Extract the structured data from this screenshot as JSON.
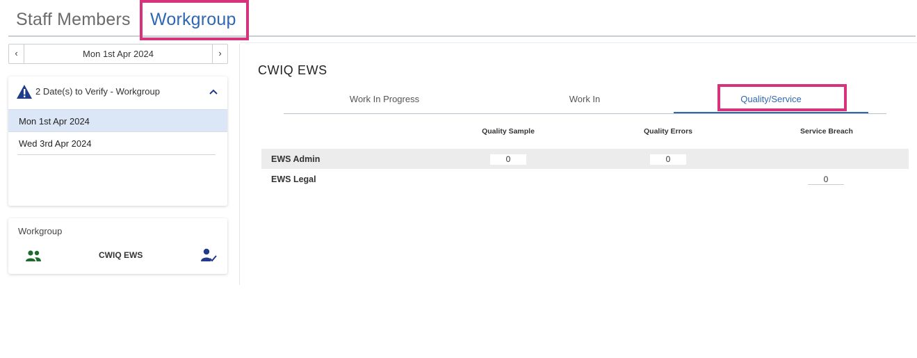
{
  "top_tabs": {
    "staff": "Staff Members",
    "workgroup": "Workgroup"
  },
  "date_nav": {
    "prev": "‹",
    "next": "›",
    "date": "Mon 1st Apr 2024"
  },
  "verify": {
    "title": "2 Date(s) to Verify - Workgroup",
    "items": [
      "Mon 1st Apr 2024",
      "Wed 3rd Apr 2024"
    ]
  },
  "workgroup_card": {
    "title": "Workgroup",
    "name": "CWIQ EWS"
  },
  "main": {
    "title": "CWIQ EWS",
    "tabs": [
      "Work In Progress",
      "Work In",
      "Quality/Service"
    ],
    "active_tab": "Quality/Service",
    "columns": [
      "Quality Sample",
      "Quality Errors",
      "Service Breach"
    ],
    "rows": [
      {
        "label": "EWS Admin",
        "quality_sample": "0",
        "quality_errors": "0",
        "service_breach": ""
      },
      {
        "label": "EWS Legal",
        "quality_sample": "",
        "quality_errors": "",
        "service_breach": "0"
      }
    ]
  },
  "colors": {
    "accent": "#2f67b1",
    "highlight": "#d6337c",
    "warning_icon": "#1f3b8a",
    "people_icon": "#1d6b2c",
    "selected_bg": "#dbe7f6"
  },
  "icons": [
    "warning-icon",
    "chevron-up-icon",
    "people-icon",
    "person-check-icon"
  ]
}
